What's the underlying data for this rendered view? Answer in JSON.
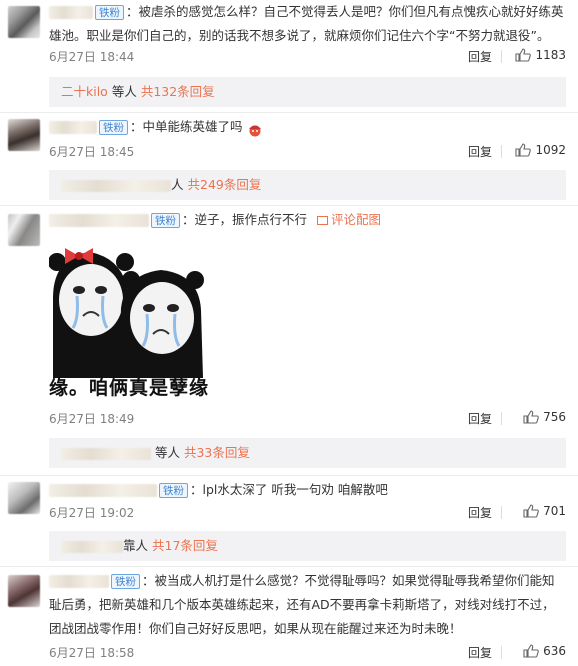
{
  "comments": [
    {
      "badge": "铁粉",
      "text": "被虐杀的感觉怎么样？自己不觉得丢人是吧？你们但凡有点愧疚心就好好练英雄池。职业是你们自己的，别的话我不想多说了，就麻烦你们记住六个字“不努力就退役”。",
      "date": "6月27日 18:44",
      "reply_label": "回复",
      "likes": "1183",
      "reply_summary": {
        "names": "二十kilo",
        "etc": "等人",
        "count_text": "共132条回复"
      }
    },
    {
      "badge": "铁粉",
      "text": "中单能练英雄了吗",
      "date": "6月27日 18:45",
      "reply_label": "回复",
      "likes": "1092",
      "reply_summary": {
        "names": "",
        "etc": "人",
        "count_text": "共249条回复"
      }
    },
    {
      "badge": "铁粉",
      "text": "逆子，振作点行不行",
      "image_link": "评论配图",
      "meme_caption": "孽缘。咱俩真是孽缘",
      "date": "6月27日 18:49",
      "reply_label": "回复",
      "likes": "756",
      "reply_summary": {
        "names": "",
        "etc": "等人",
        "count_text": "共33条回复"
      }
    },
    {
      "badge": "铁粉",
      "text": "lpl水太深了 听我一句劝 咱解散吧",
      "date": "6月27日 19:02",
      "reply_label": "回复",
      "likes": "701",
      "reply_summary": {
        "names": "",
        "etc": "靠人",
        "count_text": "共17条回复"
      }
    },
    {
      "badge": "铁粉",
      "text": "被当成人机打是什么感觉？不觉得耻辱吗？如果觉得耻辱我希望你们能知耻后勇，把新英雄和几个版本英雄练起来，还有AD不要再拿卡莉斯塔了，对线对线打不过，团战团战零作用！你们自己好好反思吧，如果从现在能醒过来还为时未晚！",
      "date": "6月27日 18:58",
      "reply_label": "回复",
      "likes": "636"
    }
  ],
  "colors": {
    "accent": "#eb7350",
    "badge_blue": "#3f86d2",
    "reply_bg": "#f2f2f5"
  }
}
